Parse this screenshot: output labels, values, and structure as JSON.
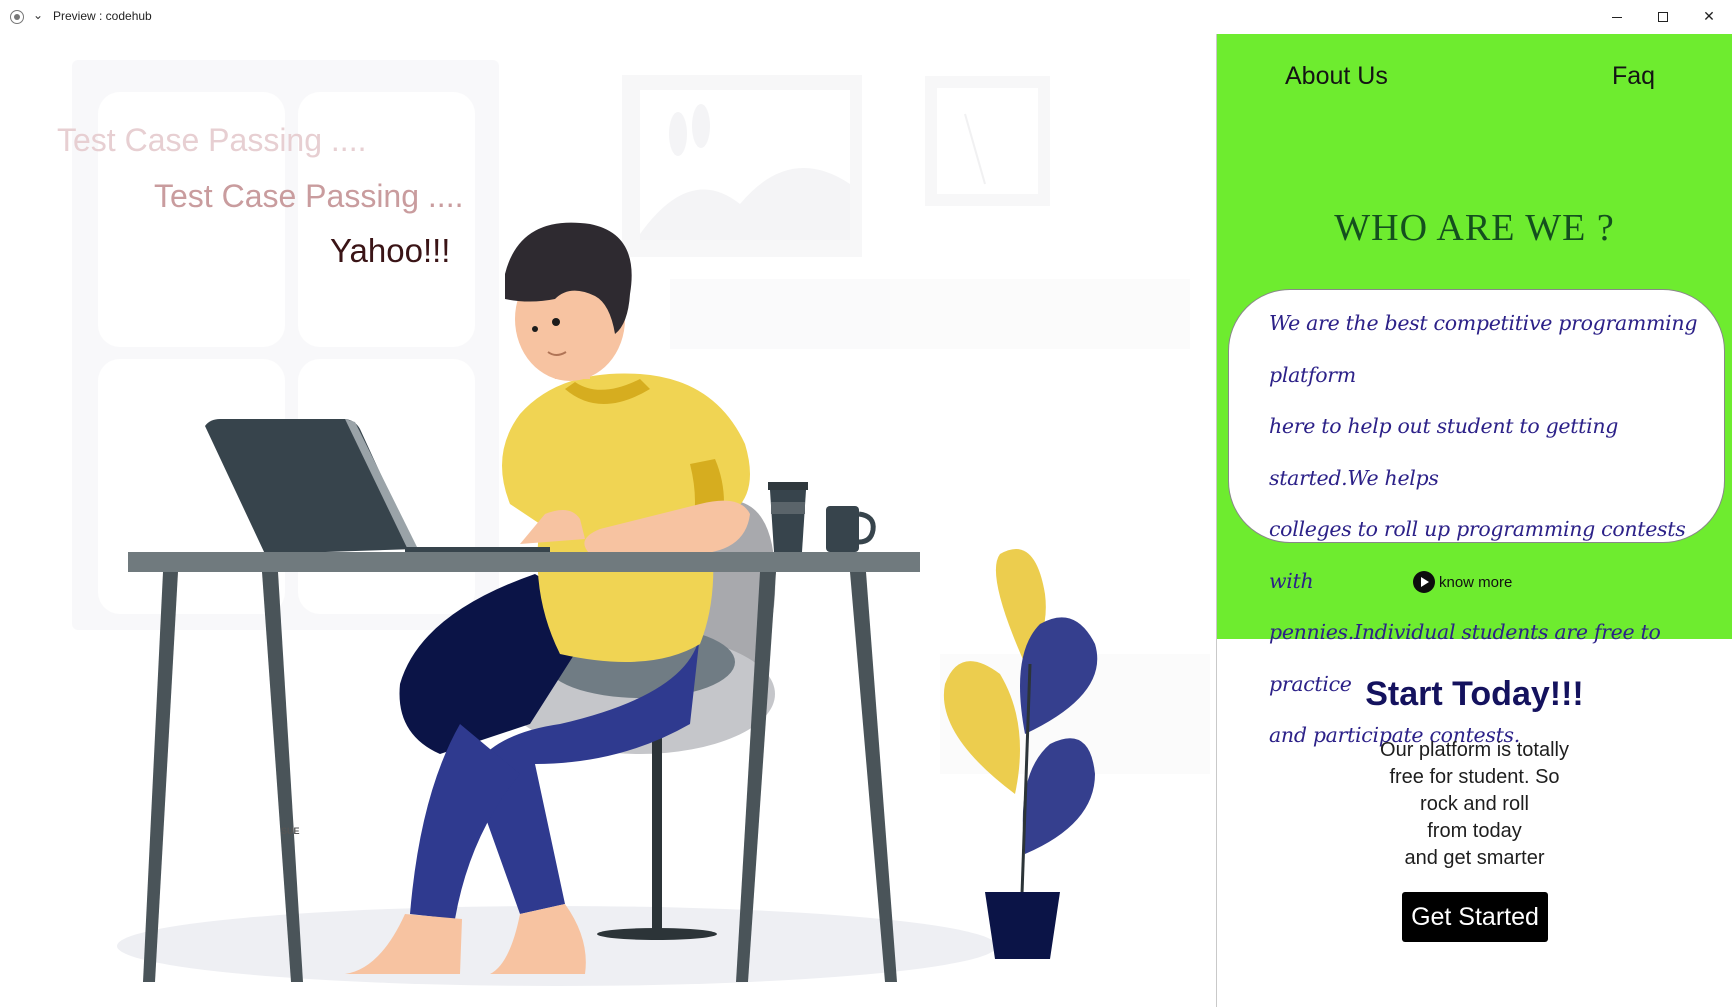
{
  "window": {
    "title": "Preview : codehub",
    "controls": {
      "minimize": "",
      "maximize": "",
      "close": "✕"
    }
  },
  "hero": {
    "lines": [
      "Test Case Passing ....",
      "Test Case Passing ....",
      "Yahoo!!!"
    ],
    "stray_text": "SUE",
    "illustration": "person-at-laptop-desk",
    "colors": {
      "shirt": "#f0d453",
      "pants": "#2f3a8f",
      "desk": "#707a7e",
      "plant_yellow": "#eccd4e",
      "plant_blue": "#353f8e",
      "laptop": "#37444c"
    }
  },
  "nav": {
    "about": "About Us",
    "faq": "Faq"
  },
  "about": {
    "heading": "WHO ARE WE ?",
    "lines": [
      "We are the best competitive programming platform",
      "here to help out student to  getting started.We helps",
      "colleges to roll up programming contests with",
      "pennies.Individual students are free to practice",
      "and participate contests."
    ],
    "know_more": "know more",
    "panel_color": "#6eec2f"
  },
  "start": {
    "title": "Start Today!!!",
    "lines": [
      "Our platform is totally",
      "free for student. So",
      "rock and roll",
      "from today",
      "and get smarter"
    ],
    "button": "Get Started"
  }
}
